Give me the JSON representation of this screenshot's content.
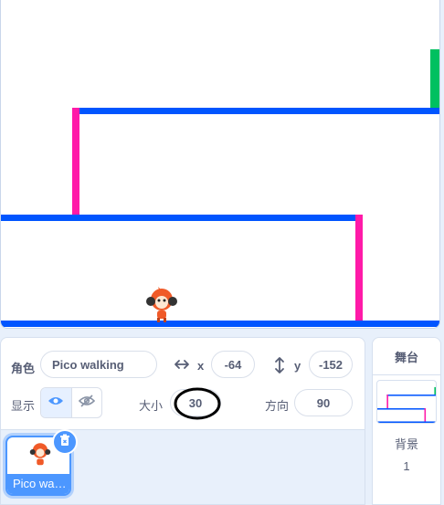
{
  "sprite_info": {
    "sprite_label": "角色",
    "sprite_name": "Pico walking",
    "x_label": "x",
    "x_value": "-64",
    "y_label": "y",
    "y_value": "-152",
    "show_label": "显示",
    "size_label": "大小",
    "size_value": "30",
    "direction_label": "方向",
    "direction_value": "90",
    "visible": true
  },
  "sprites": [
    {
      "name": "Pico wa…",
      "selected": true
    }
  ],
  "stage_pane": {
    "title": "舞台",
    "backdrops_label": "背景",
    "backdrops_count": "1"
  },
  "colors": {
    "platform": "#0055ff",
    "wall": "#ff1aa8",
    "goal": "#00c060",
    "accent": "#4c97ff"
  }
}
